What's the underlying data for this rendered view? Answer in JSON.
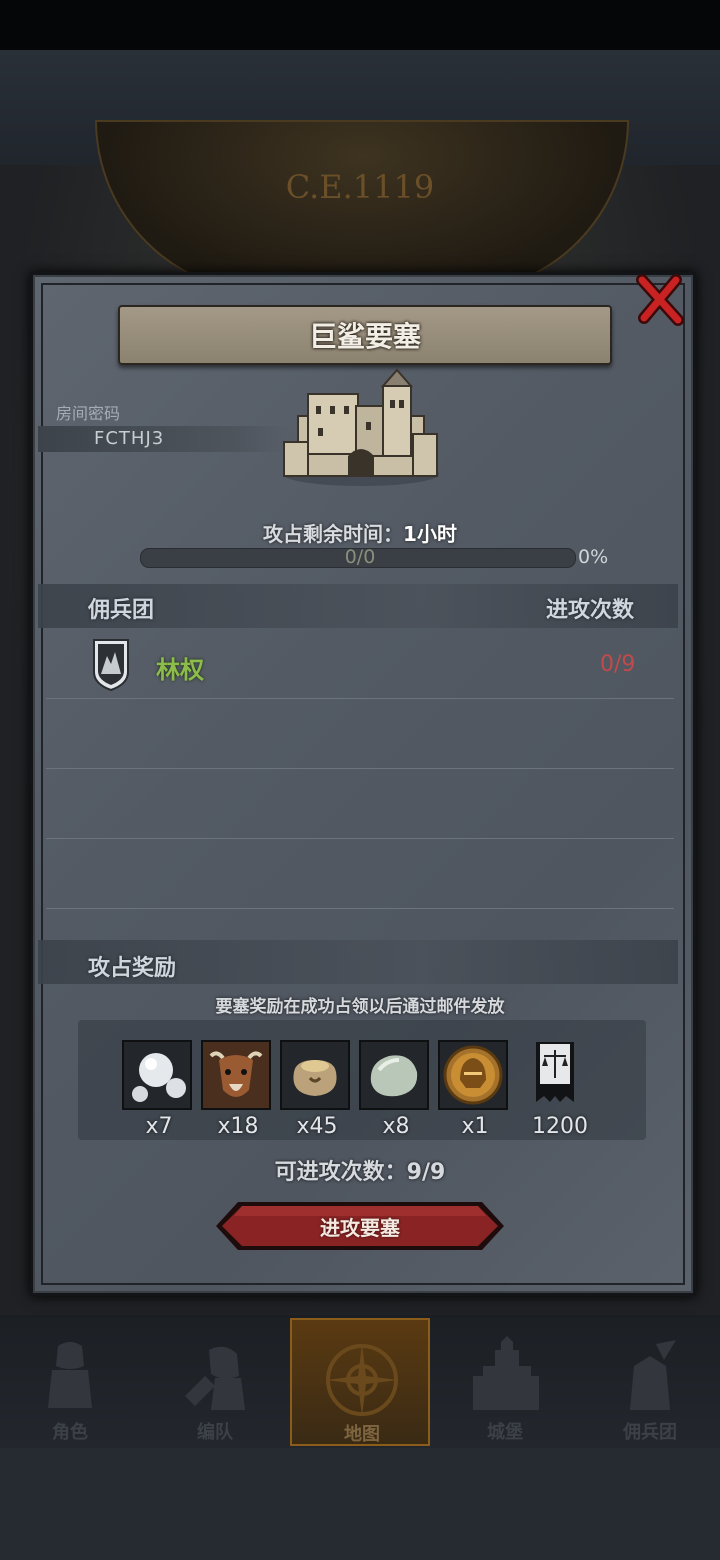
{
  "top_hud": {
    "year": "C.E.1119"
  },
  "dialog": {
    "title": "巨鲨要塞",
    "room_code_label": "房间密码",
    "room_code": "FCTHJ3",
    "time_label": "攻占剩余时间：",
    "time_value": "1小时",
    "progress_text": "0/0",
    "progress_percent": "0%",
    "progress_fraction": 0,
    "mercenary_header": "佣兵团",
    "attack_count_header": "进攻次数",
    "mercenaries": [
      {
        "name": "林权",
        "count": "0/9"
      }
    ],
    "reward_header": "攻占奖励",
    "reward_note": "要塞奖励在成功占领以后通过邮件发放",
    "rewards": [
      {
        "icon": "pearls-icon",
        "qty": "x7"
      },
      {
        "icon": "cattle-icon",
        "qty": "x18"
      },
      {
        "icon": "grain-sack-icon",
        "qty": "x45"
      },
      {
        "icon": "stone-icon",
        "qty": "x8"
      },
      {
        "icon": "helmet-coin-icon",
        "qty": "x1"
      },
      {
        "icon": "justice-banner-icon",
        "qty": "1200"
      }
    ],
    "attempts_text": "可进攻次数：9/9",
    "attack_button": "进攻要塞"
  },
  "bottom_nav": [
    {
      "label": "角色",
      "icon": "knight-icon"
    },
    {
      "label": "编队",
      "icon": "formation-icon"
    },
    {
      "label": "地图",
      "icon": "compass-icon",
      "active": true
    },
    {
      "label": "城堡",
      "icon": "castle-icon"
    },
    {
      "label": "佣兵团",
      "icon": "mercenary-icon"
    }
  ],
  "colors": {
    "accent_red": "#8a2424",
    "mercenary_green": "#8cbd4a",
    "count_red": "#c24a4a",
    "nav_active": "#8a5e1a"
  }
}
